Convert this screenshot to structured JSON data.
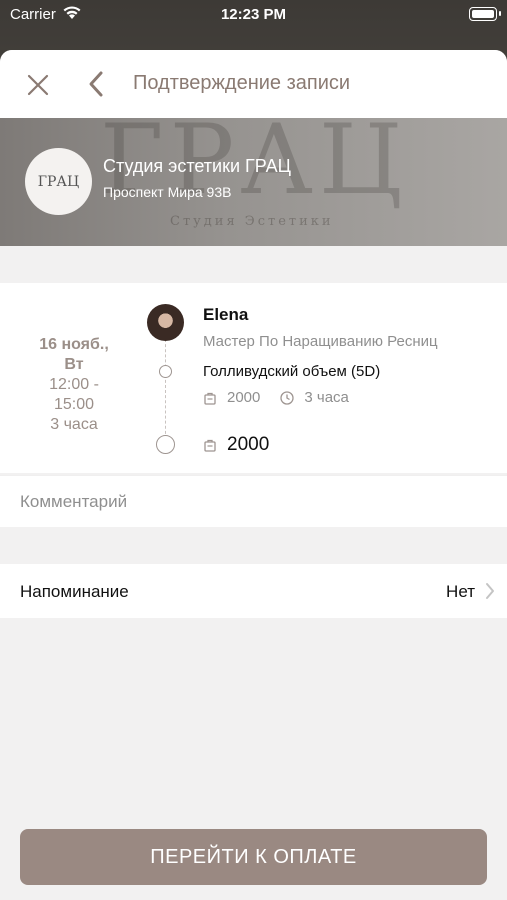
{
  "status_bar": {
    "carrier": "Carrier",
    "time": "12:23 PM"
  },
  "nav": {
    "title": "Подтверждение записи",
    "close_icon": "close-icon",
    "back_icon": "chevron-left-icon"
  },
  "studio": {
    "logo_text": "ГРАЦ",
    "watermark": "ГРАЦ",
    "watermark_sub": "Студия Эстетики",
    "name": "Студия эстетики ГРАЦ",
    "address": "Проспект Мира 93В"
  },
  "booking": {
    "date_line1": "16 нояб.,",
    "date_line2": "Вт",
    "time_line1": "12:00 -",
    "time_line2": "15:00",
    "duration": "3 часа",
    "master_name": "Elena",
    "master_role": "Мастер По Наращиванию Ресниц",
    "service_name": "Голливудский объем (5D)",
    "service_price": "2000",
    "service_duration": "3 часа",
    "total_price": "2000"
  },
  "comment": {
    "placeholder": "Комментарий",
    "value": ""
  },
  "reminder": {
    "label": "Напоминание",
    "value": "Нет"
  },
  "pay_button": {
    "label": "ПЕРЕЙТИ К ОПЛАТЕ"
  },
  "colors": {
    "accent": "#9a8982",
    "title_text": "#8a7a72",
    "date_text": "#9b8f89"
  }
}
